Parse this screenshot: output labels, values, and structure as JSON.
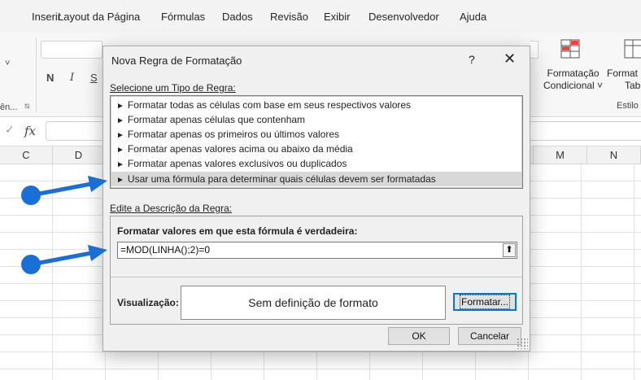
{
  "ribbon": {
    "tabs": [
      "Inserir",
      "Layout da Página",
      "Fórmulas",
      "Dados",
      "Revisão",
      "Exibir",
      "Desenvolvedor",
      "Ajuda"
    ],
    "font_buttons": [
      "N",
      "I",
      "S"
    ],
    "group_fragment": "ên...",
    "cond_format_label_1": "Formatação",
    "cond_format_label_2": "Condicional ˅",
    "table_format_label_1": "Format",
    "table_format_label_2": "Tab",
    "styles_group": "Estilo"
  },
  "formula_bar": {
    "fx_label": "fx",
    "check": "✓"
  },
  "columns": [
    "C",
    "D",
    "M",
    "N"
  ],
  "dialog": {
    "title": "Nova Regra de Formatação",
    "help": "?",
    "close": "✕",
    "select_rule_type_label": "Selecione um Tipo de Regra:",
    "rule_types": [
      "Formatar todas as células com base em seus respectivos valores",
      "Formatar apenas células que contenham",
      "Formatar apenas os primeiros ou últimos valores",
      "Formatar apenas valores acima ou abaixo da média",
      "Formatar apenas valores exclusivos ou duplicados",
      "Usar uma fórmula para determinar quais células devem ser formatadas"
    ],
    "selected_rule_index": 5,
    "edit_description_label": "Edite a Descrição da Regra:",
    "formula_label": "Formatar valores em que esta fórmula é verdadeira:",
    "formula_value": "=MOD(LINHA();2)=0",
    "preview_label": "Visualização:",
    "preview_text": "Sem definição de formato",
    "format_button": "Formatar...",
    "ok_button": "OK",
    "cancel_button": "Cancelar"
  },
  "colors": {
    "annotation_blue": "#1a6fd6",
    "selected_row": "#d8d8d8",
    "dialog_bg": "#f0f0f0"
  }
}
